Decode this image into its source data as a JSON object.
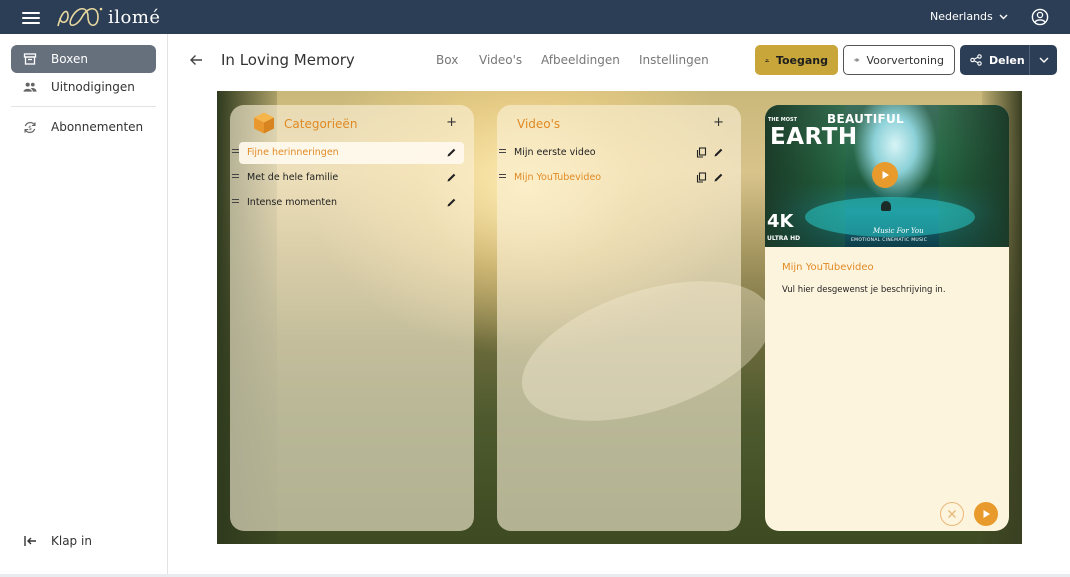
{
  "app": {
    "logo_text": "ilomé",
    "language": "Nederlands"
  },
  "sidebar": {
    "items": [
      {
        "label": "Boxen",
        "icon": "box-icon",
        "active": true
      },
      {
        "label": "Uitnodigingen",
        "icon": "people-icon",
        "active": false
      },
      {
        "label": "Abonnementen",
        "icon": "subscription-icon",
        "active": false
      }
    ],
    "collapse_label": "Klap in"
  },
  "header": {
    "title": "In Loving Memory",
    "tabs": [
      "Box",
      "Video's",
      "Afbeeldingen",
      "Instellingen"
    ],
    "toegang_label": "Toegang",
    "voorvertoning_label": "Voorvertoning",
    "delen_label": "Delen"
  },
  "categories": {
    "title": "Categorieën",
    "items": [
      {
        "label": "Fijne herinneringen",
        "selected": true
      },
      {
        "label": "Met de hele familie",
        "selected": false
      },
      {
        "label": "Intense momenten",
        "selected": false
      }
    ]
  },
  "videos": {
    "title": "Video's",
    "items": [
      {
        "label": "Mijn eerste video",
        "selected": false
      },
      {
        "label": "Mijn YouTubevideo",
        "selected": true
      }
    ]
  },
  "preview": {
    "thumbnail": {
      "small_text": "THE MOST",
      "title_line1": "BEAUTIFUL",
      "title_line2": "EARTH",
      "badge_4k": "4K",
      "badge_uhd": "ULTRA HD",
      "music_text": "Music For You",
      "tagline": "EMOTIONAL CINEMATIC MUSIC"
    },
    "title": "Mijn YouTubevideo",
    "description": "Vul hier desgewenst je beschrijving in."
  },
  "colors": {
    "topbar": "#2c3e55",
    "accent_orange": "#e08a25",
    "toegang_gold": "#c8a63a",
    "sidebar_active": "#66707d"
  }
}
